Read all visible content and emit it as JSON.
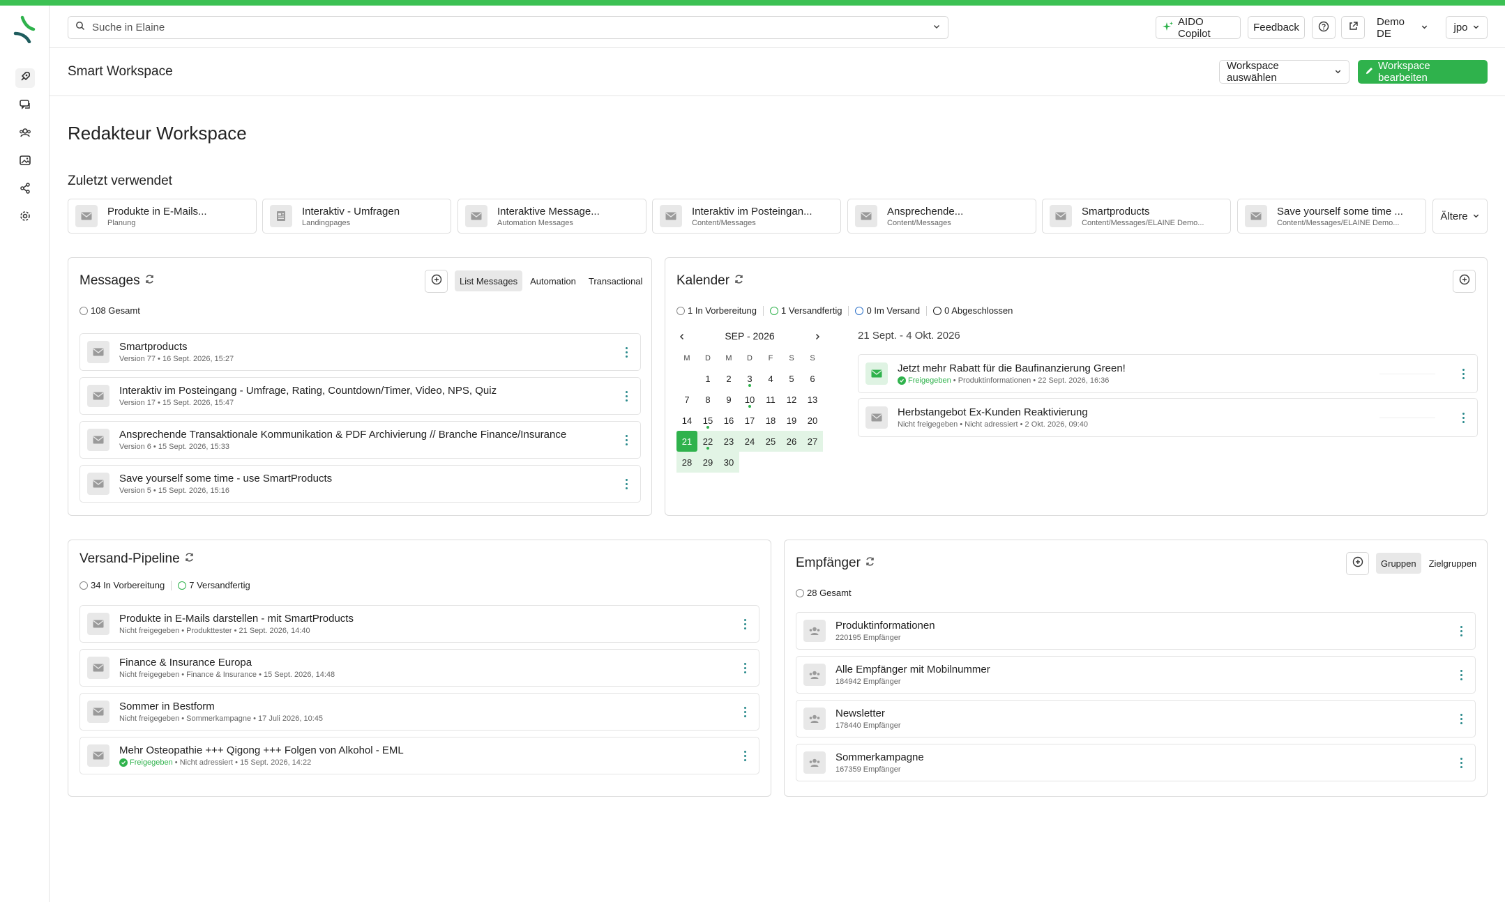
{
  "header": {
    "search_placeholder": "Suche in Elaine",
    "copilot_label": "AIDO Copilot",
    "feedback_label": "Feedback",
    "account_label": "Demo DE",
    "user_label": "jpo",
    "brand_color": "#3cc153"
  },
  "sidebar": {
    "items": [
      {
        "icon": "rocket-icon"
      },
      {
        "icon": "chat-icon"
      },
      {
        "icon": "users-icon"
      },
      {
        "icon": "image-icon"
      },
      {
        "icon": "share-icon"
      },
      {
        "icon": "gear-icon"
      }
    ]
  },
  "subheader": {
    "title": "Smart Workspace",
    "select_label": "Workspace auswählen",
    "edit_label": "Workspace bearbeiten"
  },
  "page": {
    "title": "Redakteur Workspace",
    "recent_heading": "Zuletzt verwendet",
    "older_label": "Ältere"
  },
  "recent": [
    {
      "title": "Produkte in E-Mails...",
      "sub": "Planung",
      "icon": "mail-icon"
    },
    {
      "title": "Interaktiv - Umfragen",
      "sub": "Landingpages",
      "icon": "page-icon"
    },
    {
      "title": "Interaktive Message...",
      "sub": "Automation Messages",
      "icon": "mail-icon"
    },
    {
      "title": "Interaktiv im Posteingan...",
      "sub": "Content/Messages",
      "icon": "mail-icon"
    },
    {
      "title": "Ansprechende...",
      "sub": "Content/Messages",
      "icon": "mail-icon"
    },
    {
      "title": "Smartproducts",
      "sub": "Content/Messages/ELAINE Demo...",
      "icon": "mail-icon"
    },
    {
      "title": "Save yourself some time ...",
      "sub": "Content/Messages/ELAINE Demo...",
      "icon": "mail-icon"
    }
  ],
  "messages": {
    "title": "Messages",
    "tabs": [
      "List Messages",
      "Automation",
      "Transactional"
    ],
    "total": "108 Gesamt",
    "items": [
      {
        "title": "Smartproducts",
        "meta": "Version 77 • 16 Sept. 2026, 15:27"
      },
      {
        "title": "Interaktiv im Posteingang - Umfrage, Rating, Countdown/Timer, Video, NPS, Quiz",
        "meta": "Version 17 • 15 Sept. 2026, 15:47"
      },
      {
        "title": "Ansprechende Transaktionale Kommunikation & PDF Archivierung // Branche Finance/Insurance",
        "meta": "Version 6 • 15 Sept. 2026, 15:33"
      },
      {
        "title": "Save yourself some time - use SmartProducts",
        "meta": "Version 5 • 15 Sept. 2026, 15:16"
      }
    ]
  },
  "calendar": {
    "title": "Kalender",
    "stats": [
      "1 In Vorbereitung",
      "1 Versandfertig",
      "0 Im Versand",
      "0 Abgeschlossen"
    ],
    "month_label": "SEP - 2026",
    "weekdays": [
      "M",
      "D",
      "M",
      "D",
      "F",
      "S",
      "S"
    ],
    "days": [
      "1",
      "2",
      "3",
      "4",
      "5",
      "6",
      "7",
      "8",
      "9",
      "10",
      "11",
      "12",
      "13",
      "14",
      "15",
      "16",
      "17",
      "18",
      "19",
      "20",
      "21",
      "22",
      "23",
      "24",
      "25",
      "26",
      "27",
      "28",
      "29",
      "30"
    ],
    "range_label": "21 Sept. - 4 Okt. 2026",
    "events": [
      {
        "title": "Jetzt mehr Rabatt für die Baufinanzierung Green!",
        "status": "Freigegeben",
        "meta": "• Produktinformationen • 22 Sept. 2026, 16:36"
      },
      {
        "title": "Herbstangebot Ex-Kunden Reaktivierung",
        "status": "Nicht freigegeben",
        "meta": "• Nicht adressiert • 2 Okt. 2026, 09:40"
      }
    ]
  },
  "pipeline": {
    "title": "Versand-Pipeline",
    "stats": [
      "34 In Vorbereitung",
      "7 Versandfertig"
    ],
    "items": [
      {
        "title": "Produkte in E-Mails darstellen - mit SmartProducts",
        "status": "Nicht freigegeben",
        "meta": "• Produkttester • 21 Sept. 2026, 14:40"
      },
      {
        "title": "Finance & Insurance Europa",
        "status": "Nicht freigegeben",
        "meta": "• Finance & Insurance • 15 Sept. 2026, 14:48"
      },
      {
        "title": "Sommer in Bestform",
        "status": "Nicht freigegeben",
        "meta": "• Sommerkampagne • 17 Juli 2026, 10:45"
      },
      {
        "title": "Mehr Osteopathie +++ Qigong +++ Folgen von Alkohol - EML",
        "status": "Freigegeben",
        "meta": "• Nicht adressiert • 15 Sept. 2026, 14:22"
      }
    ]
  },
  "recipients": {
    "title": "Empfänger",
    "tabs": [
      "Gruppen",
      "Zielgruppen"
    ],
    "total": "28 Gesamt",
    "items": [
      {
        "title": "Produktinformationen",
        "meta": "220195 Empfänger"
      },
      {
        "title": "Alle Empfänger mit Mobilnummer",
        "meta": "184942 Empfänger"
      },
      {
        "title": "Newsletter",
        "meta": "178440 Empfänger"
      },
      {
        "title": "Sommerkampagne",
        "meta": "167359 Empfänger"
      }
    ]
  }
}
